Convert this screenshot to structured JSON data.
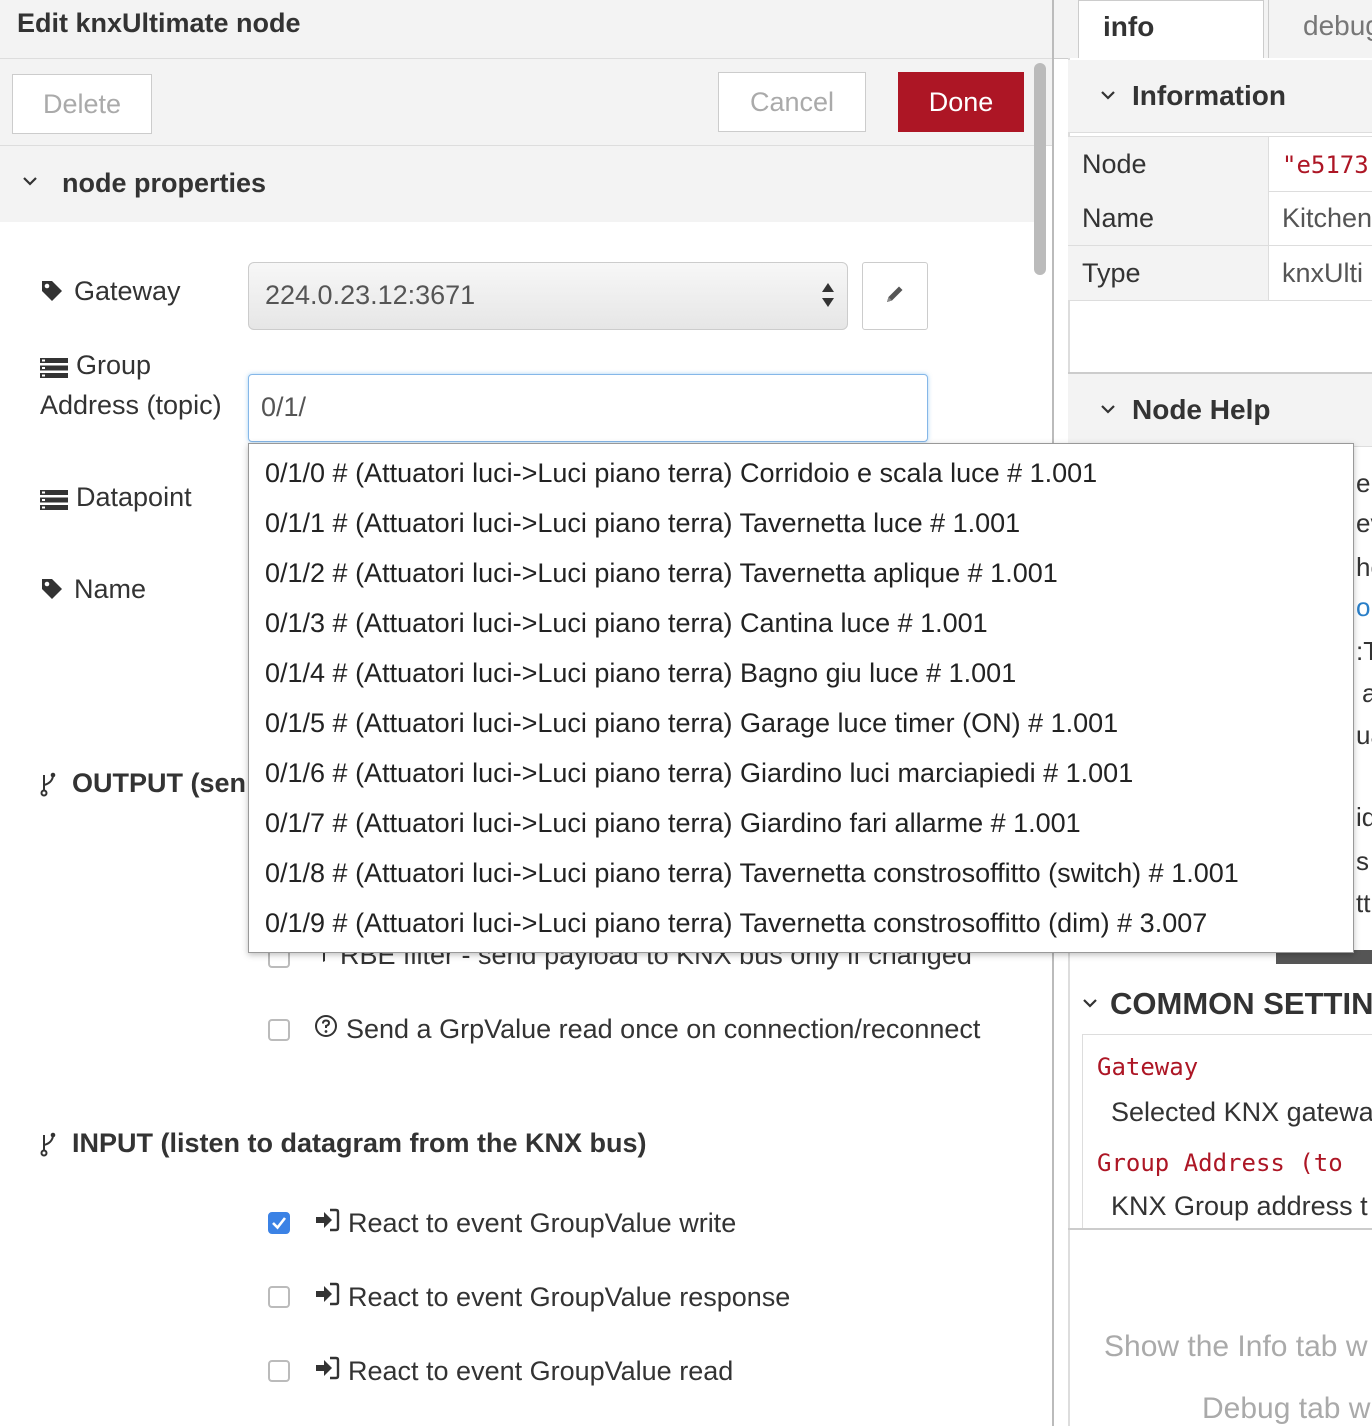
{
  "editor": {
    "title": "Edit knxUltimate node",
    "buttons": {
      "delete": "Delete",
      "cancel": "Cancel",
      "done": "Done"
    },
    "section_title": "node properties",
    "fields": {
      "gateway_label": "Gateway",
      "gateway_value": "224.0.23.12:3671",
      "group_label_line1": "Group",
      "group_label_line2": "Address (topic)",
      "group_value": "0/1/",
      "datapoint_label": "Datapoint",
      "name_label": "Name"
    },
    "output_section": "OUTPUT (sen",
    "output_options": {
      "rbe_filter": "RBE filter - send payload to KNX bus only if changed",
      "send_read_on_connect": "Send a GrpValue read once on connection/reconnect"
    },
    "input_section": "INPUT (listen to datagram from the KNX bus)",
    "input_options": [
      {
        "label": "React to event GroupValue write",
        "checked": true
      },
      {
        "label": "React to event GroupValue response",
        "checked": false
      },
      {
        "label": "React to event GroupValue read",
        "checked": false
      }
    ]
  },
  "autocomplete": [
    "0/1/0 # (Attuatori luci->Luci piano terra) Corridoio e scala luce # 1.001",
    "0/1/1 # (Attuatori luci->Luci piano terra) Tavernetta luce # 1.001",
    "0/1/2 # (Attuatori luci->Luci piano terra) Tavernetta aplique # 1.001",
    "0/1/3 # (Attuatori luci->Luci piano terra) Cantina luce # 1.001",
    "0/1/4 # (Attuatori luci->Luci piano terra) Bagno giu luce # 1.001",
    "0/1/5 # (Attuatori luci->Luci piano terra) Garage luce timer (ON) # 1.001",
    "0/1/6 # (Attuatori luci->Luci piano terra) Giardino luci marciapiedi # 1.001",
    "0/1/7 # (Attuatori luci->Luci piano terra) Giardino fari allarme # 1.001",
    "0/1/8 # (Attuatori luci->Luci piano terra) Tavernetta constrosoffitto (switch) # 1.001",
    "0/1/9 # (Attuatori luci->Luci piano terra) Tavernetta constrosoffitto (dim) # 3.007"
  ],
  "sidebar": {
    "tabs": {
      "info": "info",
      "debug": "debug"
    },
    "information_title": "Information",
    "info_rows": [
      {
        "key": "Node",
        "value": "\"e5173"
      },
      {
        "key": "Name",
        "value": "Kitchen"
      },
      {
        "key": "Type",
        "value": "knxUlti"
      }
    ],
    "node_help_title": "Node Help",
    "help_fragments": [
      "er",
      "ev",
      "he",
      "or",
      ":T",
      "a",
      "ua",
      "id",
      "s",
      "tti"
    ],
    "common_settings_title": "COMMON SETTIN",
    "help_entries": [
      {
        "key": "Gateway",
        "desc": "Selected KNX gatewa"
      },
      {
        "key": "Group Address (to",
        "desc": "KNX Group address t"
      }
    ],
    "hint_1": "Show the Info tab w",
    "hint_2": "Debug tab w"
  },
  "colors": {
    "accent": "#ad1625",
    "checkbox_checked": "#3b82e5",
    "link_blue": "#2a7fc8"
  }
}
